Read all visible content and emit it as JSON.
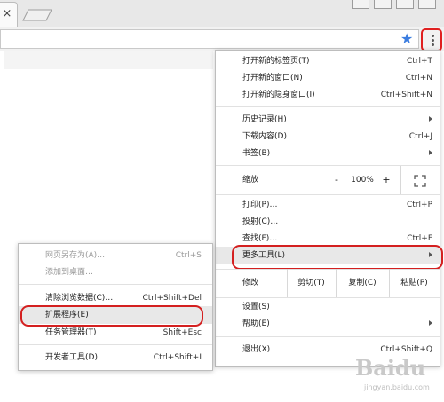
{
  "browser": {
    "tab_close": "×",
    "star": "★"
  },
  "main_menu": {
    "new_tab": {
      "label": "打开新的标签页(T)",
      "shortcut": "Ctrl+T"
    },
    "new_window": {
      "label": "打开新的窗口(N)",
      "shortcut": "Ctrl+N"
    },
    "incognito": {
      "label": "打开新的隐身窗口(I)",
      "shortcut": "Ctrl+Shift+N"
    },
    "history": {
      "label": "历史记录(H)"
    },
    "downloads": {
      "label": "下载内容(D)",
      "shortcut": "Ctrl+J"
    },
    "bookmarks": {
      "label": "书签(B)"
    },
    "zoom": {
      "label": "缩放",
      "minus": "-",
      "value": "100%",
      "plus": "+"
    },
    "print": {
      "label": "打印(P)…",
      "shortcut": "Ctrl+P"
    },
    "cast": {
      "label": "投射(C)…"
    },
    "find": {
      "label": "查找(F)…",
      "shortcut": "Ctrl+F"
    },
    "more_tools": {
      "label": "更多工具(L)"
    },
    "edit": {
      "label": "修改",
      "cut": "剪切(T)",
      "copy": "复制(C)",
      "paste": "粘贴(P)"
    },
    "settings": {
      "label": "设置(S)"
    },
    "help": {
      "label": "帮助(E)"
    },
    "exit": {
      "label": "退出(X)",
      "shortcut": "Ctrl+Shift+Q"
    }
  },
  "sub_menu": {
    "save_page": {
      "label": "网页另存为(A)…",
      "shortcut": "Ctrl+S"
    },
    "add_desktop": {
      "label": "添加到桌面…"
    },
    "clear_data": {
      "label": "清除浏览数据(C)…",
      "shortcut": "Ctrl+Shift+Del"
    },
    "extensions": {
      "label": "扩展程序(E)"
    },
    "task_manager": {
      "label": "任务管理器(T)",
      "shortcut": "Shift+Esc"
    },
    "dev_tools": {
      "label": "开发者工具(D)",
      "shortcut": "Ctrl+Shift+I"
    }
  },
  "watermark": {
    "brand": "Baidu",
    "sub": "jingyan.baidu.com"
  },
  "colors": {
    "highlight": "#e02020",
    "star": "#3b7de0",
    "hover": "#e8e8e8"
  }
}
